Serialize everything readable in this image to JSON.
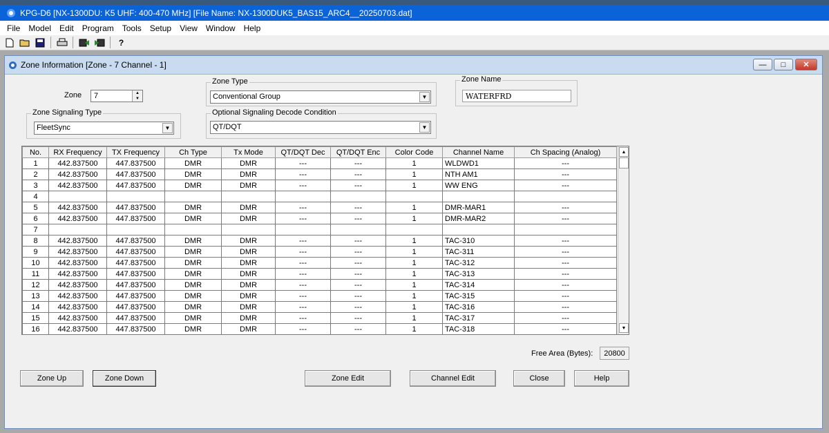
{
  "app": {
    "title": "KPG-D6 [NX-1300DU: K5 UHF: 400-470 MHz] [File Name: NX-1300DUK5_BAS15_ARC4__20250703.dat]"
  },
  "menu": [
    "File",
    "Model",
    "Edit",
    "Program",
    "Tools",
    "Setup",
    "View",
    "Window",
    "Help"
  ],
  "toolbar_icons": [
    "new-file-icon",
    "open-folder-icon",
    "save-disk-icon",
    "print-icon",
    "read-radio-icon",
    "write-radio-icon",
    "help-icon"
  ],
  "window": {
    "title": "Zone Information [Zone - 7   Channel  -  1]",
    "controls": {
      "minimize": "—",
      "restore": "□",
      "close": "✕"
    }
  },
  "zone": {
    "label": "Zone",
    "value": "7"
  },
  "zone_type": {
    "label": "Zone Type",
    "value": "Conventional Group"
  },
  "zone_name": {
    "label": "Zone Name",
    "value": "WATERFRD"
  },
  "zone_signaling": {
    "label": "Zone Signaling Type",
    "value": "FleetSync"
  },
  "optional_decode": {
    "label": "Optional Signaling Decode Condition",
    "value": "QT/DQT"
  },
  "table": {
    "columns": [
      "No.",
      "RX Frequency",
      "TX Frequency",
      "Ch Type",
      "Tx Mode",
      "QT/DQT Dec",
      "QT/DQT Enc",
      "Color Code",
      "Channel Name",
      "Ch Spacing (Analog)"
    ],
    "rows": [
      [
        "1",
        "442.837500",
        "447.837500",
        "DMR",
        "DMR",
        "---",
        "---",
        "1",
        "WLDWD1",
        "---"
      ],
      [
        "2",
        "442.837500",
        "447.837500",
        "DMR",
        "DMR",
        "---",
        "---",
        "1",
        "NTH AM1",
        "---"
      ],
      [
        "3",
        "442.837500",
        "447.837500",
        "DMR",
        "DMR",
        "---",
        "---",
        "1",
        "WW ENG",
        "---"
      ],
      [
        "4",
        "",
        "",
        "",
        "",
        "",
        "",
        "",
        "",
        ""
      ],
      [
        "5",
        "442.837500",
        "447.837500",
        "DMR",
        "DMR",
        "---",
        "---",
        "1",
        "DMR-MAR1",
        "---"
      ],
      [
        "6",
        "442.837500",
        "447.837500",
        "DMR",
        "DMR",
        "---",
        "---",
        "1",
        "DMR-MAR2",
        "---"
      ],
      [
        "7",
        "",
        "",
        "",
        "",
        "",
        "",
        "",
        "",
        ""
      ],
      [
        "8",
        "442.837500",
        "447.837500",
        "DMR",
        "DMR",
        "---",
        "---",
        "1",
        "TAC-310",
        "---"
      ],
      [
        "9",
        "442.837500",
        "447.837500",
        "DMR",
        "DMR",
        "---",
        "---",
        "1",
        "TAC-311",
        "---"
      ],
      [
        "10",
        "442.837500",
        "447.837500",
        "DMR",
        "DMR",
        "---",
        "---",
        "1",
        "TAC-312",
        "---"
      ],
      [
        "11",
        "442.837500",
        "447.837500",
        "DMR",
        "DMR",
        "---",
        "---",
        "1",
        "TAC-313",
        "---"
      ],
      [
        "12",
        "442.837500",
        "447.837500",
        "DMR",
        "DMR",
        "---",
        "---",
        "1",
        "TAC-314",
        "---"
      ],
      [
        "13",
        "442.837500",
        "447.837500",
        "DMR",
        "DMR",
        "---",
        "---",
        "1",
        "TAC-315",
        "---"
      ],
      [
        "14",
        "442.837500",
        "447.837500",
        "DMR",
        "DMR",
        "---",
        "---",
        "1",
        "TAC-316",
        "---"
      ],
      [
        "15",
        "442.837500",
        "447.837500",
        "DMR",
        "DMR",
        "---",
        "---",
        "1",
        "TAC-317",
        "---"
      ],
      [
        "16",
        "442.837500",
        "447.837500",
        "DMR",
        "DMR",
        "---",
        "---",
        "1",
        "TAC-318",
        "---"
      ]
    ]
  },
  "free_area": {
    "label": "Free Area (Bytes):",
    "value": "20800"
  },
  "buttons": {
    "zone_up": "Zone Up",
    "zone_down": "Zone Down",
    "zone_edit": "Zone Edit",
    "channel_edit": "Channel Edit",
    "close": "Close",
    "help": "Help"
  }
}
